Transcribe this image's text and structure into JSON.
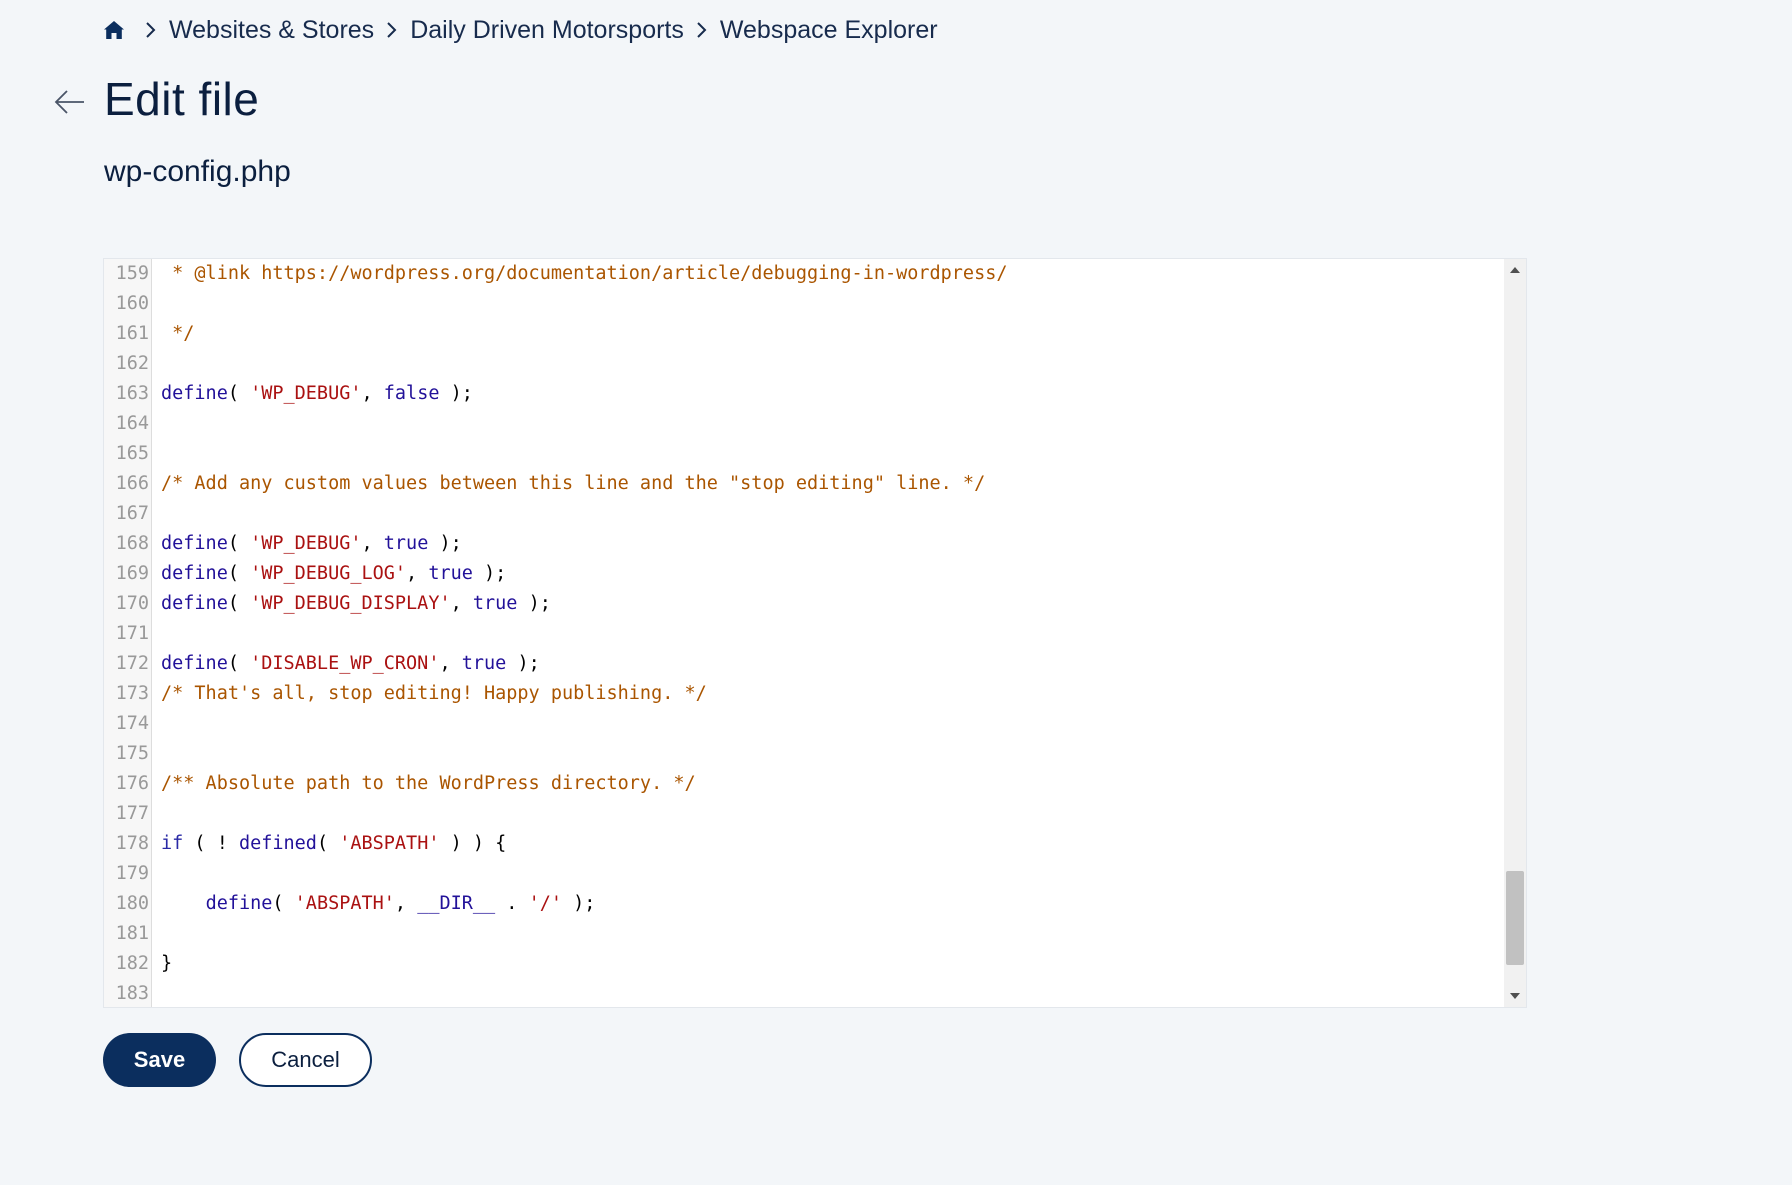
{
  "breadcrumb": {
    "home_icon": "home-icon",
    "items": [
      "Websites & Stores",
      "Daily Driven Motorsports",
      "Webspace Explorer"
    ]
  },
  "header": {
    "title": "Edit file",
    "back_icon": "arrow-left-icon"
  },
  "file": {
    "name": "wp-config.php"
  },
  "editor": {
    "lines": [
      {
        "n": "159",
        "tokens": [
          {
            "t": " * @link https://wordpress.org/documentation/article/debugging-in-wordpress/",
            "c": "comment"
          }
        ]
      },
      {
        "n": "160",
        "tokens": []
      },
      {
        "n": "161",
        "tokens": [
          {
            "t": " */",
            "c": "comment"
          }
        ]
      },
      {
        "n": "162",
        "tokens": []
      },
      {
        "n": "163",
        "tokens": [
          {
            "t": "define",
            "c": "fn"
          },
          {
            "t": "( ",
            "c": "plain"
          },
          {
            "t": "'WP_DEBUG'",
            "c": "str"
          },
          {
            "t": ", ",
            "c": "plain"
          },
          {
            "t": "false",
            "c": "atom"
          },
          {
            "t": " );",
            "c": "plain"
          }
        ]
      },
      {
        "n": "164",
        "tokens": []
      },
      {
        "n": "165",
        "tokens": []
      },
      {
        "n": "166",
        "tokens": [
          {
            "t": "/* Add any custom values between this line and the \"stop editing\" line. */",
            "c": "comment"
          }
        ]
      },
      {
        "n": "167",
        "tokens": []
      },
      {
        "n": "168",
        "tokens": [
          {
            "t": "define",
            "c": "fn"
          },
          {
            "t": "( ",
            "c": "plain"
          },
          {
            "t": "'WP_DEBUG'",
            "c": "str"
          },
          {
            "t": ", ",
            "c": "plain"
          },
          {
            "t": "true",
            "c": "atom"
          },
          {
            "t": " );",
            "c": "plain"
          }
        ]
      },
      {
        "n": "169",
        "tokens": [
          {
            "t": "define",
            "c": "fn"
          },
          {
            "t": "( ",
            "c": "plain"
          },
          {
            "t": "'WP_DEBUG_LOG'",
            "c": "str"
          },
          {
            "t": ", ",
            "c": "plain"
          },
          {
            "t": "true",
            "c": "atom"
          },
          {
            "t": " );",
            "c": "plain"
          }
        ]
      },
      {
        "n": "170",
        "tokens": [
          {
            "t": "define",
            "c": "fn"
          },
          {
            "t": "( ",
            "c": "plain"
          },
          {
            "t": "'WP_DEBUG_DISPLAY'",
            "c": "str"
          },
          {
            "t": ", ",
            "c": "plain"
          },
          {
            "t": "true",
            "c": "atom"
          },
          {
            "t": " );",
            "c": "plain"
          }
        ]
      },
      {
        "n": "171",
        "tokens": []
      },
      {
        "n": "172",
        "tokens": [
          {
            "t": "define",
            "c": "fn"
          },
          {
            "t": "( ",
            "c": "plain"
          },
          {
            "t": "'DISABLE_WP_CRON'",
            "c": "str"
          },
          {
            "t": ", ",
            "c": "plain"
          },
          {
            "t": "true",
            "c": "atom"
          },
          {
            "t": " );",
            "c": "plain"
          }
        ]
      },
      {
        "n": "173",
        "tokens": [
          {
            "t": "/* That's all, stop editing! Happy publishing. */",
            "c": "comment"
          }
        ]
      },
      {
        "n": "174",
        "tokens": []
      },
      {
        "n": "175",
        "tokens": []
      },
      {
        "n": "176",
        "tokens": [
          {
            "t": "/** Absolute path to the WordPress directory. */",
            "c": "comment"
          }
        ]
      },
      {
        "n": "177",
        "tokens": []
      },
      {
        "n": "178",
        "tokens": [
          {
            "t": "if",
            "c": "kw"
          },
          {
            "t": " ( ! ",
            "c": "plain"
          },
          {
            "t": "defined",
            "c": "fn"
          },
          {
            "t": "( ",
            "c": "plain"
          },
          {
            "t": "'ABSPATH'",
            "c": "str"
          },
          {
            "t": " ) ) {",
            "c": "plain"
          }
        ]
      },
      {
        "n": "179",
        "tokens": []
      },
      {
        "n": "180",
        "tokens": [
          {
            "t": "    ",
            "c": "plain"
          },
          {
            "t": "define",
            "c": "fn"
          },
          {
            "t": "( ",
            "c": "plain"
          },
          {
            "t": "'ABSPATH'",
            "c": "str"
          },
          {
            "t": ", ",
            "c": "plain"
          },
          {
            "t": "__DIR__",
            "c": "atom"
          },
          {
            "t": " . ",
            "c": "plain"
          },
          {
            "t": "'/'",
            "c": "str"
          },
          {
            "t": " );",
            "c": "plain"
          }
        ]
      },
      {
        "n": "181",
        "tokens": []
      },
      {
        "n": "182",
        "tokens": [
          {
            "t": "}",
            "c": "plain"
          }
        ]
      },
      {
        "n": "183",
        "tokens": []
      }
    ],
    "scroll_up_icon": "triangle-up-icon",
    "scroll_down_icon": "triangle-down-icon"
  },
  "actions": {
    "save_label": "Save",
    "cancel_label": "Cancel"
  },
  "colors": {
    "background": "#f3f6f9",
    "primary": "#0b2e5e",
    "comment": "#aa5500",
    "string": "#aa1111",
    "keyword": "#221199"
  }
}
